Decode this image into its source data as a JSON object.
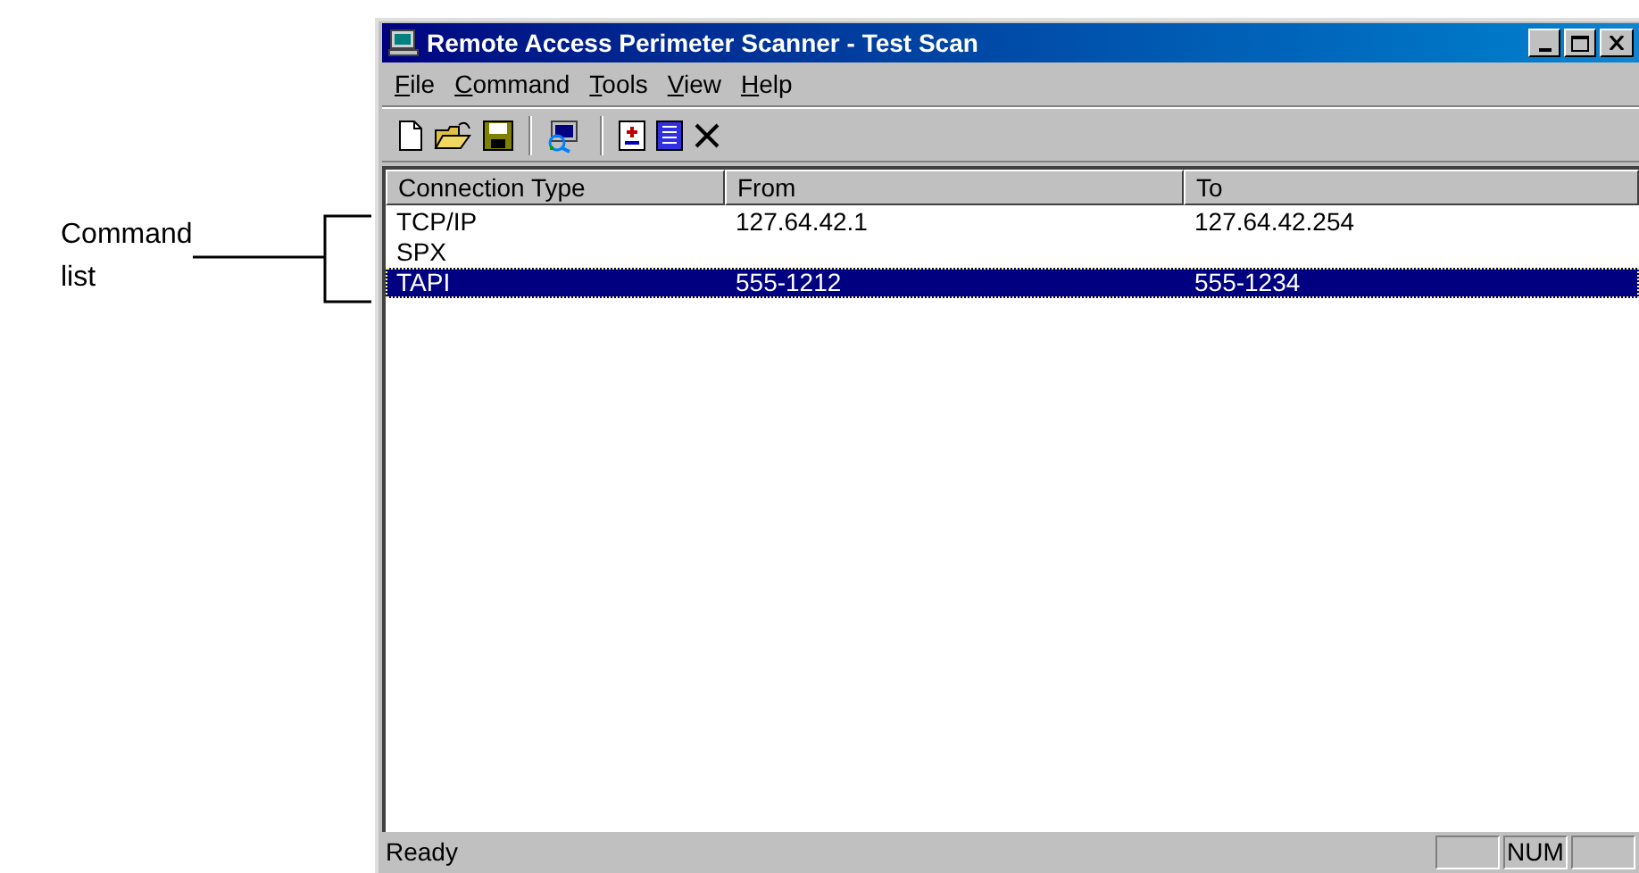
{
  "annotation": {
    "label": "Command\nlist"
  },
  "window": {
    "title": "Remote Access Perimeter Scanner - Test Scan"
  },
  "menu": [
    "File",
    "Command",
    "Tools",
    "View",
    "Help"
  ],
  "table": {
    "columns": [
      "Connection Type",
      "From",
      "To"
    ],
    "rows": [
      {
        "cells": [
          "TCP/IP",
          "127.64.42.1",
          "127.64.42.254"
        ],
        "selected": false
      },
      {
        "cells": [
          "SPX",
          "",
          ""
        ],
        "selected": false
      },
      {
        "cells": [
          "TAPI",
          "555-1212",
          "555-1234"
        ],
        "selected": true
      }
    ]
  },
  "status_bar": {
    "text": "Ready",
    "indicators": [
      "NUM"
    ]
  }
}
